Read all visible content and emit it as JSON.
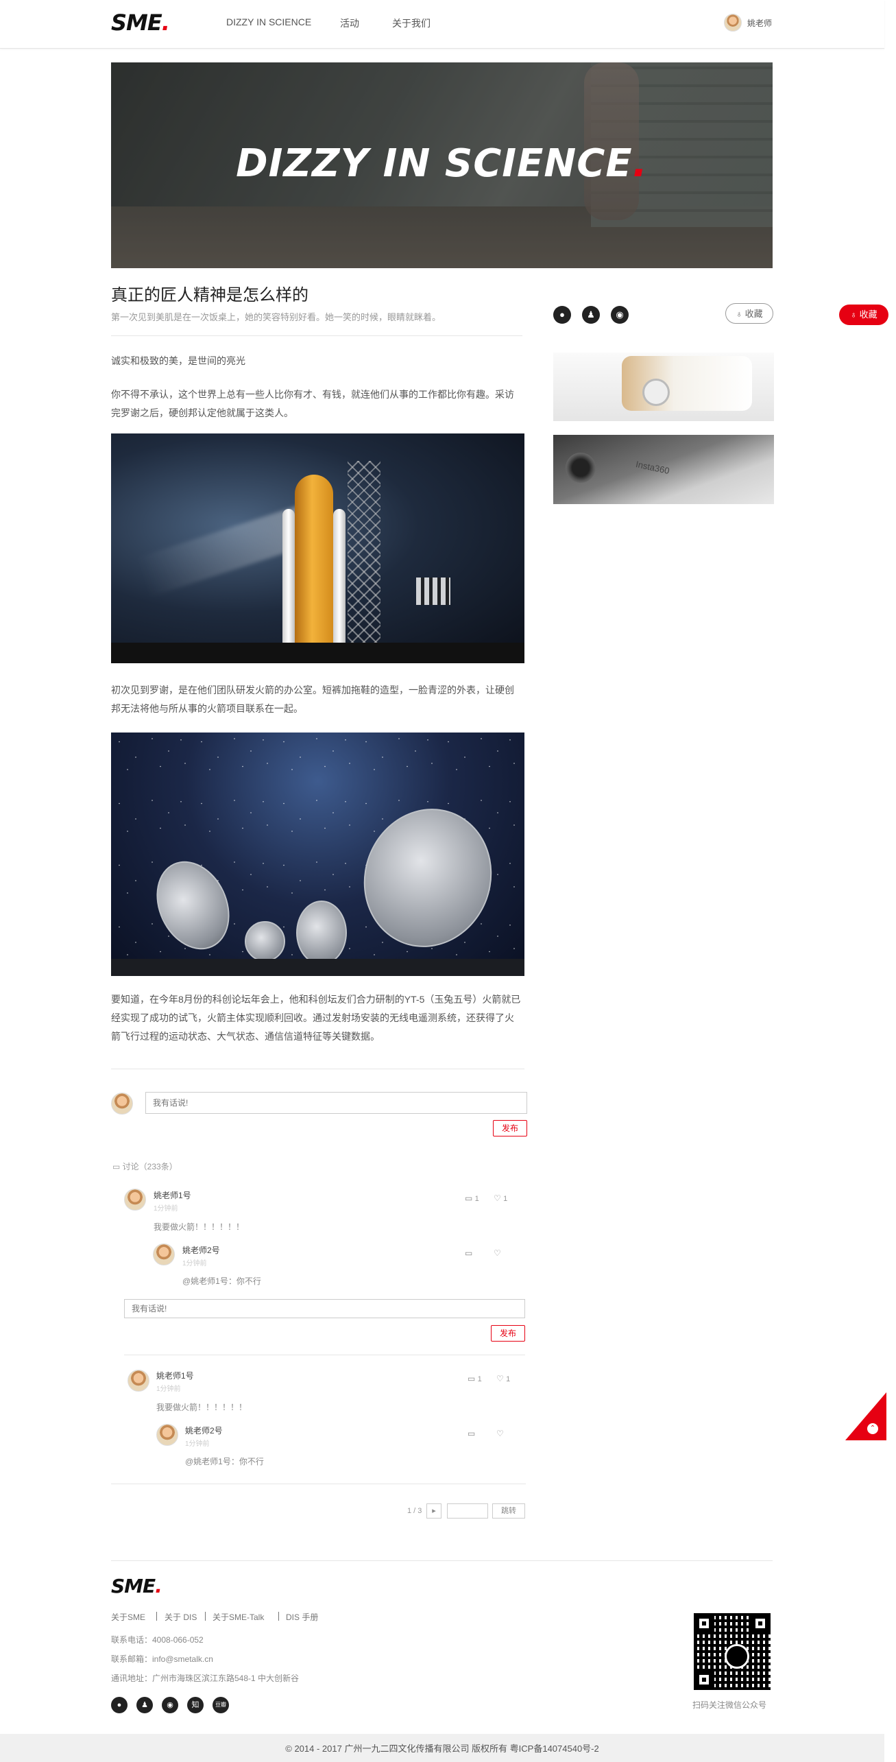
{
  "header": {
    "logo": "SME",
    "logo_dot": ".",
    "nav": [
      "DIZZY IN SCIENCE",
      "活动",
      "关于我们"
    ],
    "user": "姚老师"
  },
  "banner": {
    "title": "DIZZY IN SCIENCE",
    "dot": "."
  },
  "article": {
    "title": "真正的匠人精神是怎么样的",
    "subtitle": "第一次见到美肌是在一次饭桌上，她的笑容特别好看。她一笑的时候，眼睛就眯着。",
    "p1": "诚实和极致的美，是世间的亮光",
    "p2": "你不得不承认，这个世界上总有一些人比你有才、有钱，就连他们从事的工作都比你有趣。采访完罗谢之后，硬创邦认定他就属于这类人。",
    "p3": "初次见到罗谢，是在他们团队研发火箭的办公室。短裤加拖鞋的造型，一脸青涩的外表，让硬创邦无法将他与所从事的火箭项目联系在一起。",
    "p4": "要知道，在今年8月份的科创论坛年会上，他和科创坛友们合力研制的YT-5（玉兔五号）火箭就已经实现了成功的试飞，火箭主体实现顺利回收。通过发射场安装的无线电遥测系统，还获得了火箭飞行过程的运动状态、大气状态、通信信道特征等关键数据。"
  },
  "sidebar": {
    "fav_label": "收藏",
    "fav_float_label": "收藏",
    "share_icons": [
      "wechat-icon",
      "qq-icon",
      "weibo-icon"
    ],
    "side_img2_text": "Insta360"
  },
  "comment_box": {
    "placeholder": "我有话说!",
    "submit": "发布"
  },
  "discussion": {
    "label": "讨论（233条）",
    "threads": [
      {
        "name": "姚老师1号",
        "time": "1分钟前",
        "text": "我要做火箭！！！！！！",
        "reply_count": "1",
        "like_count": "1",
        "reply": {
          "name": "姚老师2号",
          "time": "1分钟前",
          "text": "@姚老师1号：你不行"
        },
        "reply_box_placeholder": "我有话说!",
        "reply_box_submit": "发布"
      },
      {
        "name": "姚老师1号",
        "time": "1分钟前",
        "text": "我要做火箭！！！！！！",
        "reply_count": "1",
        "like_count": "1",
        "reply": {
          "name": "姚老师2号",
          "time": "1分钟前",
          "text": "@姚老师1号：你不行"
        }
      }
    ]
  },
  "pager": {
    "label": "1 / 3",
    "next": "▸",
    "jump": "跳转"
  },
  "footer": {
    "logo": "SME",
    "links": [
      "关于SME",
      "关于 DIS",
      "关于SME-Talk",
      "DIS 手册"
    ],
    "phone": "联系电话：4008-066-052",
    "email": "联系邮箱：info@smetalk.cn",
    "address": "通讯地址：广州市海珠区滨江东路548-1 中大创新谷",
    "qr_caption": "扫码关注微信公众号",
    "social": [
      "wechat-icon",
      "qq-icon",
      "weibo-icon",
      "zhihu-icon",
      "douban-icon"
    ],
    "social_zhihu": "知",
    "social_extra": "豆瓣",
    "copyright": "© 2014 - 2017 广州一九二四文化传播有限公司   版权所有   粤ICP备14074540号-2"
  }
}
